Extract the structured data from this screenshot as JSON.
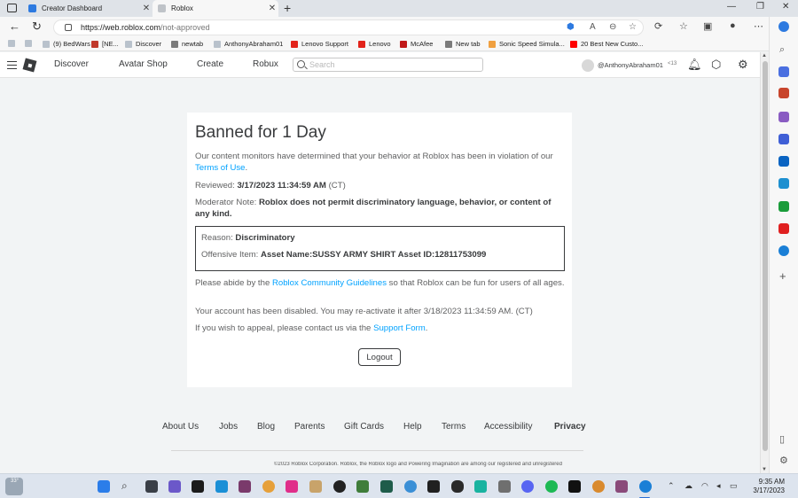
{
  "browser": {
    "tabs": [
      {
        "label": "Creator Dashboard",
        "fav_color": "#2d7ae0"
      },
      {
        "label": "Roblox",
        "fav_color": "#bfc3c8"
      }
    ],
    "url_host": "https://web.roblox.com",
    "url_path": "/not-approved",
    "notification_count": "2",
    "bookmarks": [
      {
        "label": "",
        "color": "#b9c2cc"
      },
      {
        "label": "",
        "color": "#b9c2cc"
      },
      {
        "label": "(9) BedWars",
        "color": "#b9c2cc"
      },
      {
        "label": "[NE...",
        "color": "#c0392b"
      },
      {
        "label": "Discover",
        "color": "#b9c2cc"
      },
      {
        "label": "newtab",
        "color": "#7b7b7b"
      },
      {
        "label": "AnthonyAbraham01",
        "color": "#b9c2cc"
      },
      {
        "label": "Lenovo Support",
        "color": "#e2231a"
      },
      {
        "label": "Lenovo",
        "color": "#e2231a"
      },
      {
        "label": "McAfee",
        "color": "#c01818"
      },
      {
        "label": "New tab",
        "color": "#7b7b7b"
      },
      {
        "label": "Sonic Speed Simula...",
        "color": "#f0a040"
      },
      {
        "label": "20 Best New Custo...",
        "color": "#ff0000"
      }
    ]
  },
  "roblox_header": {
    "nav": [
      "Discover",
      "Avatar Shop",
      "Create",
      "Robux"
    ],
    "search_placeholder": "Search",
    "username": "@AnthonyAbraham01",
    "age_label": "<13"
  },
  "ban": {
    "title": "Banned for 1 Day",
    "intro_text": "Our content monitors have determined that your behavior at Roblox has been in violation of our ",
    "terms_link": "Terms of Use",
    "intro_end": ".",
    "reviewed_label": "Reviewed: ",
    "reviewed_value": "3/17/2023 11:34:59 AM",
    "reviewed_tz": " (CT)",
    "note_label": "Moderator Note: ",
    "note_value": "Roblox does not permit discriminatory language, behavior, or content of any kind.",
    "reason_label": "Reason: ",
    "reason_value": "Discriminatory",
    "item_label": "Offensive Item: ",
    "item_value": "Asset Name:SUSSY ARMY SHIRT Asset ID:12811753099",
    "abide_text": "Please abide by the ",
    "guidelines_link": "Roblox Community Guidelines",
    "abide_end": " so that Roblox can be fun for users of all ages.",
    "disabled_text": "Your account has been disabled. You may re-activate it after 3/18/2023 11:34:59 AM. (CT)",
    "appeal_text": "If you wish to appeal, please contact us via the ",
    "support_link": "Support Form",
    "appeal_end": ".",
    "logout_label": "Logout"
  },
  "footer": {
    "links": [
      "About Us",
      "Jobs",
      "Blog",
      "Parents",
      "Gift Cards",
      "Help",
      "Terms",
      "Accessibility",
      "Privacy"
    ],
    "copyright": "©2023 Roblox Corporation. Roblox, the Roblox logo and Powering Imagination are among our registered and unregistered"
  },
  "taskbar": {
    "temperature": "33°",
    "time": "9:35 AM",
    "date": "3/17/2023"
  },
  "colors": {
    "link": "#00a2ff",
    "page_bg": "#f2f4f5",
    "text_dark": "#393b3d"
  }
}
